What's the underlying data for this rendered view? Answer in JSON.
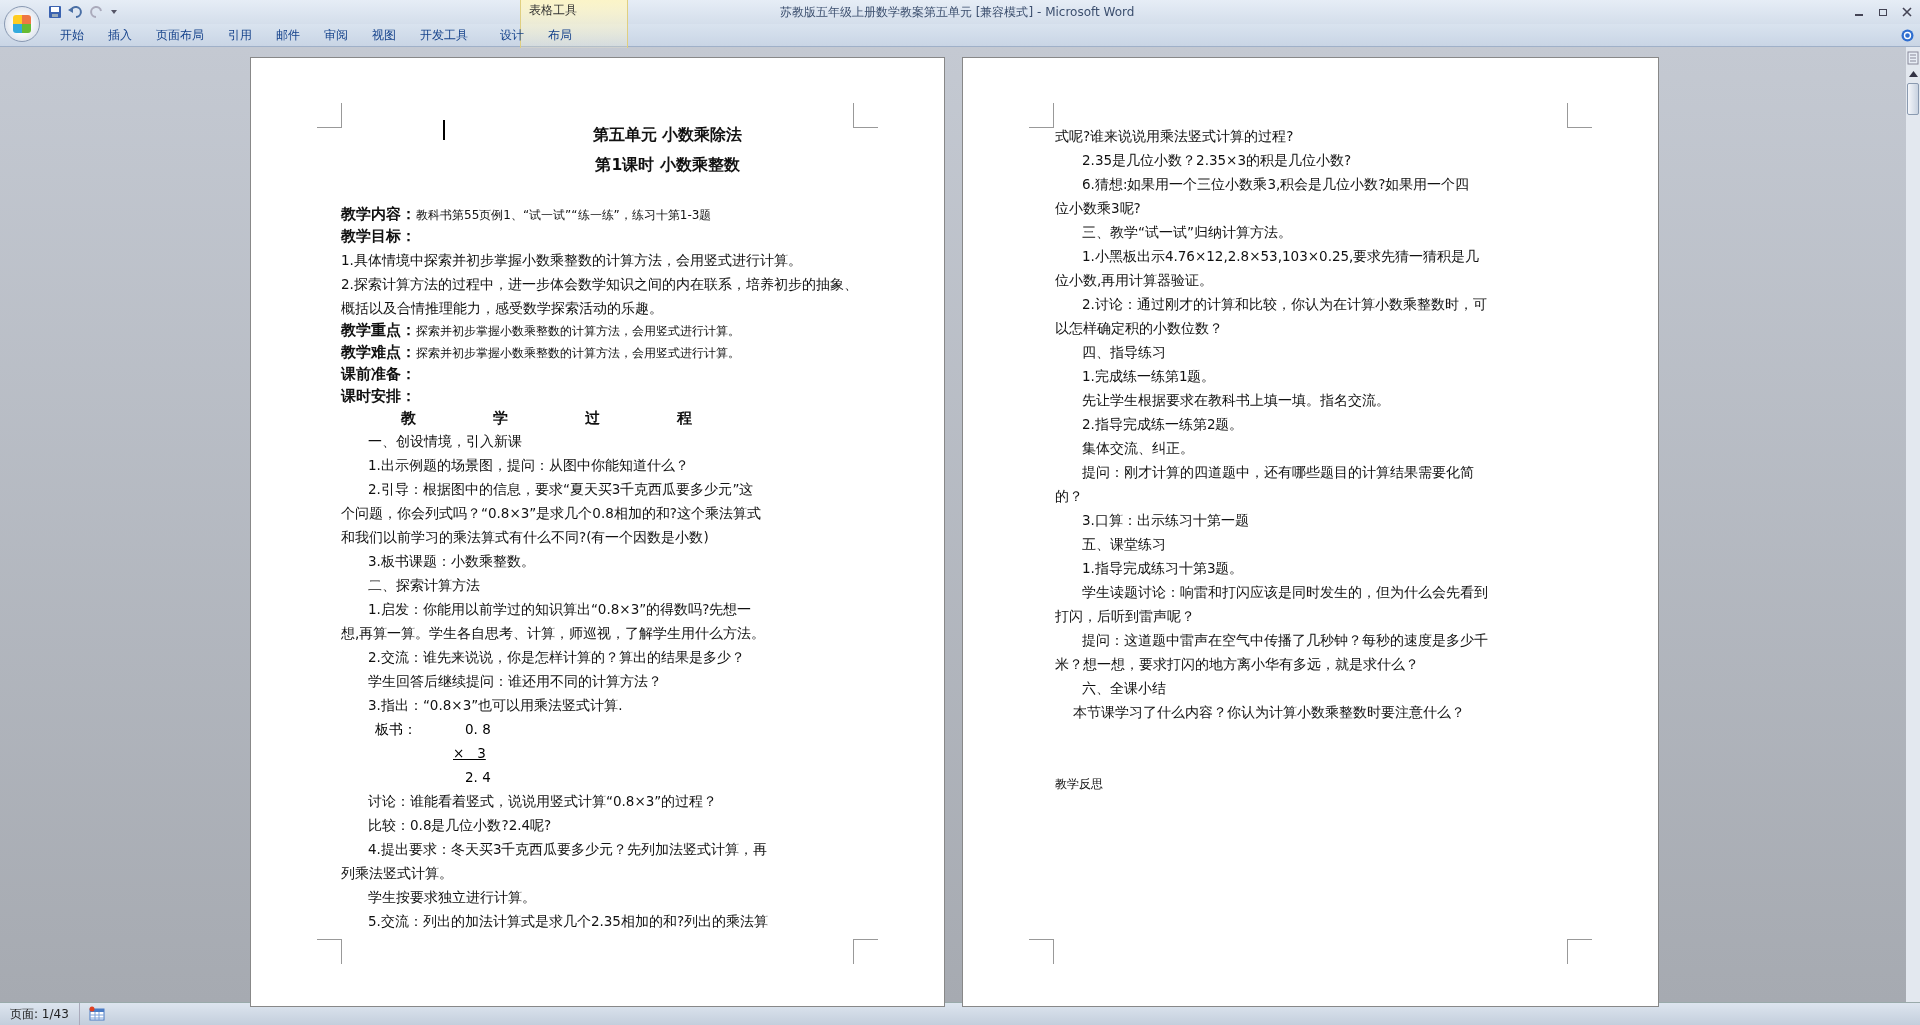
{
  "window": {
    "title": "苏教版五年级上册数学教案第五单元 [兼容模式] - Microsoft Word",
    "contextual_group": "表格工具"
  },
  "ribbon_tabs": [
    {
      "label": "开始",
      "selected": false
    },
    {
      "label": "插入",
      "selected": false
    },
    {
      "label": "页面布局",
      "selected": false
    },
    {
      "label": "引用",
      "selected": false
    },
    {
      "label": "邮件",
      "selected": false
    },
    {
      "label": "审阅",
      "selected": false
    },
    {
      "label": "视图",
      "selected": false
    },
    {
      "label": "开发工具",
      "selected": false
    }
  ],
  "contextual_tabs": [
    {
      "label": "设计",
      "selected": false
    },
    {
      "label": "布局",
      "selected": false
    }
  ],
  "pages": [
    {
      "paragraphs": [
        {
          "kind": "title",
          "lines": [
            "第五单元 小数乘除法"
          ]
        },
        {
          "kind": "title",
          "lines": [
            "第1课时  小数乘整数"
          ]
        },
        {
          "kind": "blank"
        },
        {
          "kind": "label",
          "lines": [
            "**教学内容：**教科书第55页例1、“试一试”“练一练”，练习十第1-3题"
          ]
        },
        {
          "kind": "label",
          "lines": [
            "**教学目标：**"
          ]
        },
        {
          "kind": "plain",
          "lines": [
            "1.具体情境中探索并初步掌握小数乘整数的计算方法，会用竖式进行计算。"
          ]
        },
        {
          "kind": "plain",
          "lines": [
            "2.探索计算方法的过程中，进一步体会数学知识之间的内在联系，培养初步的抽象、",
            "概括以及合情推理能力，感受数学探索活动的乐趣。"
          ]
        },
        {
          "kind": "label",
          "lines": [
            "**教学重点：**探索并初步掌握小数乘整数的计算方法，会用竖式进行计算。"
          ]
        },
        {
          "kind": "label",
          "lines": [
            "**教学难点：**探索并初步掌握小数乘整数的计算方法，会用竖式进行计算。"
          ]
        },
        {
          "kind": "label",
          "lines": [
            "**课前准备：**"
          ]
        },
        {
          "kind": "label",
          "lines": [
            "**课时安排：**"
          ]
        },
        {
          "kind": "spread",
          "lines": [
            "教 学 过 程"
          ]
        },
        {
          "kind": "indented",
          "lines": [
            "一、创设情境，引入新课"
          ]
        },
        {
          "kind": "indented",
          "lines": [
            "1.出示例题的场景图，提问：从图中你能知道什么？"
          ]
        },
        {
          "kind": "indented",
          "lines": [
            "2.引导：根据图中的信息，要求“夏天买3千克西瓜要多少元”这",
            "个问题，你会列式吗？“0.8×3”是求几个0.8相加的和?这个乘法算式",
            "和我们以前学习的乘法算式有什么不同?(有一个因数是小数)"
          ]
        },
        {
          "kind": "indented",
          "lines": [
            "3.板书课题：小数乘整数。"
          ]
        },
        {
          "kind": "indented",
          "lines": [
            "二、探索计算方法"
          ]
        },
        {
          "kind": "indented",
          "lines": [
            "1.启发：你能用以前学过的知识算出“0.8×3”的得数吗?先想一",
            "想,再算一算。学生各自思考、计算，师巡视，了解学生用什么方法。"
          ]
        },
        {
          "kind": "indented",
          "lines": [
            "2.交流：谁先来说说，你是怎样计算的？算出的结果是多少？"
          ]
        },
        {
          "kind": "indented",
          "lines": [
            "学生回答后继续提问：谁还用不同的计算方法？"
          ]
        },
        {
          "kind": "indented",
          "lines": [
            "3.指出：“0.8×3”也可以用乘法竖式计算."
          ]
        },
        {
          "kind": "calc",
          "label": "板书：",
          "rows": [
            {
              "text": "0. 8",
              "underline": false
            },
            {
              "text": "×   3",
              "underline": true
            },
            {
              "text": "2. 4",
              "underline": false
            }
          ]
        },
        {
          "kind": "indented",
          "lines": [
            "讨论：谁能看着竖式，说说用竖式计算“0.8×3”的过程？"
          ]
        },
        {
          "kind": "indented",
          "lines": [
            "比较：0.8是几位小数?2.4呢?"
          ]
        },
        {
          "kind": "indented",
          "lines": [
            "4.提出要求：冬天买3千克西瓜要多少元？先列加法竖式计算，再",
            "列乘法竖式计算。"
          ]
        },
        {
          "kind": "indented",
          "lines": [
            "学生按要求独立进行计算。"
          ]
        },
        {
          "kind": "indented",
          "lines": [
            "5.交流：列出的加法计算式是求几个2.35相加的和?列出的乘法算"
          ]
        }
      ]
    },
    {
      "paragraphs": [
        {
          "kind": "plain",
          "lines": [
            "式呢?谁来说说用乘法竖式计算的过程?"
          ]
        },
        {
          "kind": "indented",
          "lines": [
            "2.35是几位小数？2.35×3的积是几位小数?"
          ]
        },
        {
          "kind": "indented",
          "lines": [
            "6.猜想:如果用一个三位小数乘3,积会是几位小数?如果用一个四",
            "位小数乘3呢?"
          ]
        },
        {
          "kind": "indented",
          "lines": [
            "三、教学“试一试”归纳计算方法。"
          ]
        },
        {
          "kind": "indented",
          "lines": [
            "1.小黑板出示4.76×12,2.8×53,103×0.25,要求先猜一猜积是几",
            "位小数,再用计算器验证。"
          ]
        },
        {
          "kind": "indented",
          "lines": [
            "2.讨论：通过刚才的计算和比较，你认为在计算小数乘整数时，可",
            "以怎样确定积的小数位数？"
          ]
        },
        {
          "kind": "indented",
          "lines": [
            "四、指导练习"
          ]
        },
        {
          "kind": "indented",
          "lines": [
            "1.完成练一练第1题。"
          ]
        },
        {
          "kind": "indented",
          "lines": [
            "先让学生根据要求在教科书上填一填。指名交流。"
          ]
        },
        {
          "kind": "indented",
          "lines": [
            "2.指导完成练一练第2题。"
          ]
        },
        {
          "kind": "indented",
          "lines": [
            "集体交流、纠正。"
          ]
        },
        {
          "kind": "indented",
          "lines": [
            "提问：刚才计算的四道题中，还有哪些题目的计算结果需要化简",
            "的？"
          ]
        },
        {
          "kind": "indented",
          "lines": [
            "3.口算：出示练习十第一题"
          ]
        },
        {
          "kind": "indented",
          "lines": [
            "五、课堂练习"
          ]
        },
        {
          "kind": "indented",
          "lines": [
            "1.指导完成练习十第3题。"
          ]
        },
        {
          "kind": "indented",
          "lines": [
            "学生读题讨论：响雷和打闪应该是同时发生的，但为什么会先看到",
            "打闪，后听到雷声呢？"
          ]
        },
        {
          "kind": "indented",
          "lines": [
            "提问：这道题中雷声在空气中传播了几秒钟？每秒的速度是多少千",
            "米？想一想，要求打闪的地方离小华有多远，就是求什么？"
          ]
        },
        {
          "kind": "indented",
          "lines": [
            "六、全课小结"
          ]
        },
        {
          "kind": "semiindented",
          "lines": [
            "本节课学习了什么内容？你认为计算小数乘整数时要注意什么？"
          ]
        },
        {
          "kind": "blank"
        },
        {
          "kind": "blank"
        },
        {
          "kind": "small",
          "lines": [
            "教学反思"
          ]
        }
      ]
    }
  ],
  "status_bar": {
    "page": "页面: 1/43"
  }
}
